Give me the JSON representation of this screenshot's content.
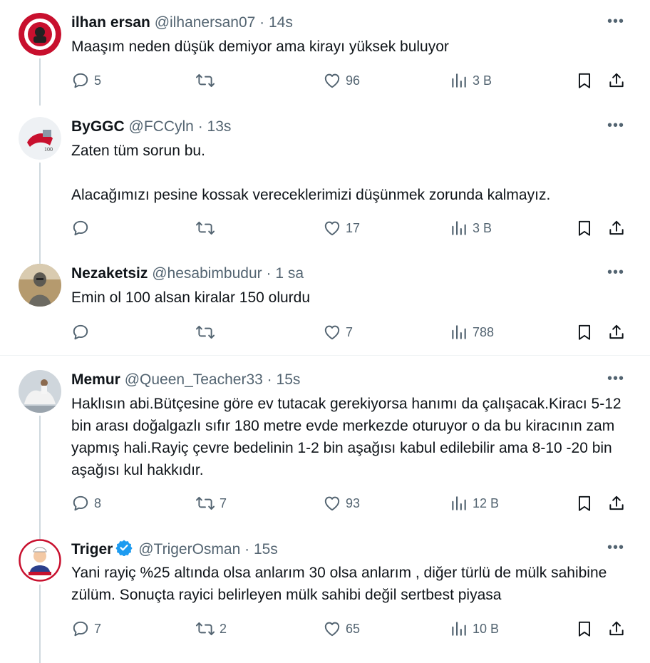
{
  "colors": {
    "text": "#0f1419",
    "muted": "#536471",
    "verified": "#1d9bf0",
    "line": "#cfd9de"
  },
  "tweets": [
    {
      "name": "ilhan ersan",
      "handle": "@ilhanersan07",
      "dot": "·",
      "time": "14s",
      "body": "Maaşım neden düşük demiyor ama kirayı yüksek buluyor",
      "replies": "5",
      "retweets": "",
      "likes": "96",
      "views": "3 B",
      "avatar_icon": "red-circle-emblem-avatar-icon"
    },
    {
      "name": "ByGGC",
      "handle": "@FCCyln",
      "dot": "·",
      "time": "13s",
      "body": "Zaten tüm sorun bu.\n\nAlacağımızı pesine kossak vereceklerimizi düşünmek zorunda kalmayız.",
      "replies": "",
      "retweets": "",
      "likes": "17",
      "views": "3 B",
      "avatar_icon": "emblem-avatar-icon"
    },
    {
      "name": "Nezaketsiz",
      "handle": "@hesabimbudur",
      "dot": "·",
      "time": "1 sa",
      "body": "Emin ol 100 alsan kiralar 150 olurdu",
      "replies": "",
      "retweets": "",
      "likes": "7",
      "views": "788",
      "avatar_icon": "armored-figure-avatar-icon"
    },
    {
      "name": "Memur",
      "handle": "@Queen_Teacher33",
      "dot": "·",
      "time": "15s",
      "body": "Haklısın abi.Bütçesine göre ev tutacak gerekiyorsa hanımı da çalışacak.Kiracı 5-12 bin arası doğalgazlı sıfır 180 metre evde merkezde oturuyor o da bu kiracının zam yapmış hali.Rayiç çevre bedelinin 1-2 bin aşağısı kabul edilebilir ama 8-10 -20 bin aşağısı kul hakkıdır.",
      "replies": "8",
      "retweets": "7",
      "likes": "93",
      "views": "12 B",
      "avatar_icon": "horse-rider-avatar-icon"
    },
    {
      "name": "Triger",
      "handle": "@TrigerOsman",
      "dot": "·",
      "time": "15s",
      "body": "Yani rayiç %25 altında olsa anlarım 30 olsa anlarım , diğer türlü de mülk sahibine zülüm. Sonuçta rayici belirleyen mülk sahibi değil sertbest piyasa",
      "replies": "7",
      "retweets": "2",
      "likes": "65",
      "views": "10 B",
      "avatar_icon": "cartoon-chef-avatar-icon"
    }
  ]
}
